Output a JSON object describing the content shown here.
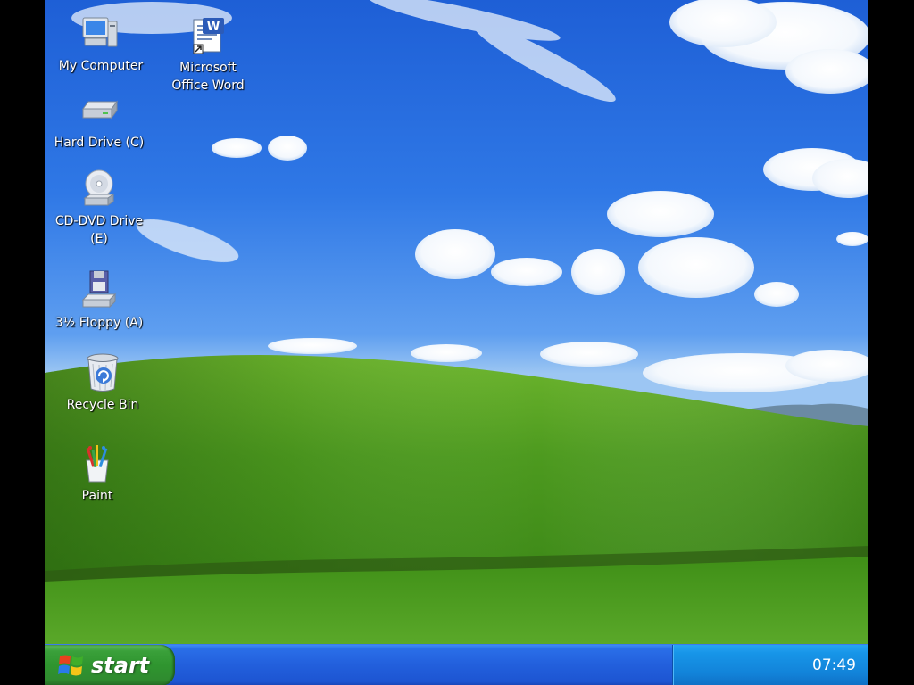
{
  "desktop": {
    "icons": [
      {
        "label": "My Computer",
        "icon": "my-computer-icon"
      },
      {
        "label": "Microsoft\nOffice Word",
        "icon": "word-icon"
      },
      {
        "label": "Hard Drive  (C)",
        "icon": "hard-drive-icon"
      },
      {
        "label": "CD-DVD Drive\n(E)",
        "icon": "cd-dvd-drive-icon"
      },
      {
        "label": "3½ Floppy (A)",
        "icon": "floppy-icon"
      },
      {
        "label": "Recycle Bin",
        "icon": "recycle-bin-icon"
      },
      {
        "label": "Paint",
        "icon": "paint-icon"
      }
    ]
  },
  "taskbar": {
    "start_label": "start",
    "clock": "07:49"
  },
  "colors": {
    "sky": "#2f78e6",
    "grass": "#4c9a1e",
    "taskbar": "#225fdc",
    "start_button": "#2f952f",
    "tray": "#1283d9"
  }
}
